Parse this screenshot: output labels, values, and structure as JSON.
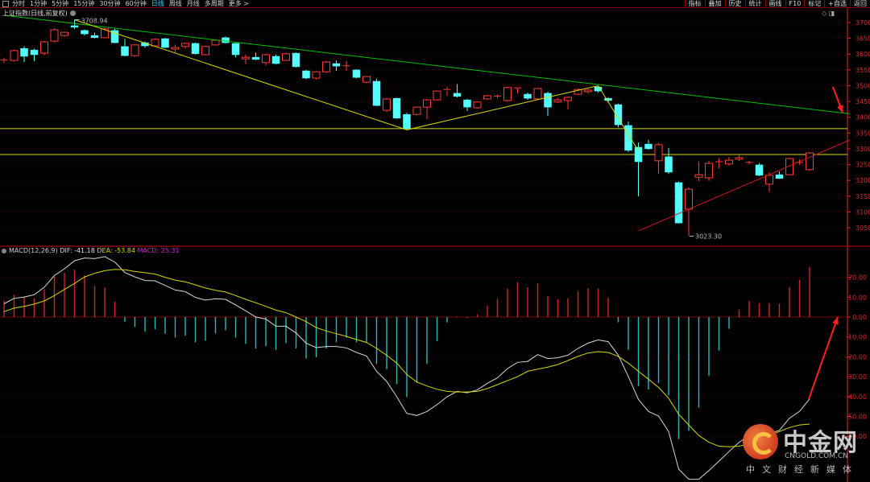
{
  "toolbar": {
    "periods": [
      "分时",
      "1分钟",
      "5分钟",
      "15分钟",
      "30分钟",
      "60分钟",
      "日线",
      "周线",
      "月线",
      "多周期",
      "更多 >"
    ],
    "active_period": "日线",
    "right_buttons": [
      "指标",
      "叠加",
      "历史",
      "统计",
      "画线",
      "F10",
      "标记",
      "+自选",
      "返回"
    ]
  },
  "title": "上证指数(日线,前复权)",
  "macd_header": {
    "name": "MACD(12,26,9)",
    "dif": "DIF: -41.18",
    "dea": "DEA: -53.84",
    "macd": "MACD: 25.31"
  },
  "annotations": {
    "high_label": "3708.94",
    "low_label": "3023.30"
  },
  "watermark": {
    "brand": "中金网",
    "url": "CNGOLD.COM.CN",
    "tagline": "中文财经新媒体"
  },
  "colors": {
    "up": "#ff3b3b",
    "down": "#54fcfc",
    "dif": "#d8d8d8",
    "dea": "#d8d800",
    "axis": "#e02828",
    "trend_green": "#00c000",
    "trend_yellow": "#d8d800",
    "trend_red": "#d01818"
  },
  "chart_data": [
    {
      "type": "candlestick",
      "title": "上证指数(日线,前复权)",
      "ylim": [
        3020,
        3720
      ],
      "yticks": [
        3700,
        3650,
        3600,
        3550,
        3500,
        3450,
        3400,
        3350,
        3300,
        3250,
        3200,
        3150,
        3100,
        3050
      ],
      "ohlc": [
        [
          3580,
          3588,
          3572,
          3581
        ],
        [
          3580,
          3614,
          3576,
          3611
        ],
        [
          3618,
          3625,
          3575,
          3593
        ],
        [
          3613,
          3617,
          3578,
          3598
        ],
        [
          3603,
          3642,
          3596,
          3639
        ],
        [
          3641,
          3682,
          3638,
          3677
        ],
        [
          3659,
          3671,
          3655,
          3669
        ],
        [
          3690,
          3709,
          3680,
          3685
        ],
        [
          3675,
          3678,
          3659,
          3664
        ],
        [
          3659,
          3668,
          3650,
          3652
        ],
        [
          3652,
          3683,
          3650,
          3680
        ],
        [
          3675,
          3680,
          3634,
          3636
        ],
        [
          3624,
          3648,
          3593,
          3595
        ],
        [
          3595,
          3631,
          3592,
          3629
        ],
        [
          3636,
          3640,
          3620,
          3626
        ],
        [
          3626,
          3649,
          3624,
          3647
        ],
        [
          3649,
          3651,
          3619,
          3621
        ],
        [
          3616,
          3630,
          3606,
          3621
        ],
        [
          3624,
          3637,
          3617,
          3634
        ],
        [
          3634,
          3636,
          3599,
          3601
        ],
        [
          3598,
          3627,
          3596,
          3624
        ],
        [
          3629,
          3646,
          3627,
          3644
        ],
        [
          3652,
          3656,
          3634,
          3636
        ],
        [
          3634,
          3636,
          3590,
          3598
        ],
        [
          3585,
          3598,
          3568,
          3590
        ],
        [
          3590,
          3605,
          3581,
          3583
        ],
        [
          3573,
          3601,
          3565,
          3598
        ],
        [
          3593,
          3598,
          3567,
          3570
        ],
        [
          3580,
          3604,
          3578,
          3601
        ],
        [
          3603,
          3605,
          3558,
          3560
        ],
        [
          3547,
          3550,
          3521,
          3524
        ],
        [
          3524,
          3546,
          3520,
          3544
        ],
        [
          3544,
          3578,
          3540,
          3575
        ],
        [
          3570,
          3580,
          3547,
          3562
        ],
        [
          3562,
          3578,
          3547,
          3563
        ],
        [
          3550,
          3552,
          3523,
          3526
        ],
        [
          3511,
          3531,
          3508,
          3529
        ],
        [
          3514,
          3522,
          3435,
          3437
        ],
        [
          3422,
          3460,
          3417,
          3458
        ],
        [
          3460,
          3462,
          3395,
          3397
        ],
        [
          3409,
          3414,
          3360,
          3364
        ],
        [
          3409,
          3434,
          3406,
          3432
        ],
        [
          3432,
          3457,
          3393,
          3455
        ],
        [
          3455,
          3485,
          3452,
          3483
        ],
        [
          3485,
          3497,
          3468,
          3488
        ],
        [
          3476,
          3505,
          3463,
          3466
        ],
        [
          3455,
          3458,
          3420,
          3432
        ],
        [
          3430,
          3450,
          3428,
          3448
        ],
        [
          3458,
          3471,
          3455,
          3468
        ],
        [
          3466,
          3472,
          3460,
          3467
        ],
        [
          3453,
          3496,
          3450,
          3494
        ],
        [
          3491,
          3494,
          3475,
          3493
        ],
        [
          3473,
          3478,
          3455,
          3460
        ],
        [
          3458,
          3493,
          3456,
          3491
        ],
        [
          3476,
          3481,
          3405,
          3432
        ],
        [
          3448,
          3460,
          3446,
          3455
        ],
        [
          3453,
          3466,
          3425,
          3463
        ],
        [
          3473,
          3491,
          3470,
          3488
        ],
        [
          3481,
          3490,
          3476,
          3486
        ],
        [
          3496,
          3500,
          3478,
          3483
        ],
        [
          3460,
          3463,
          3445,
          3453
        ],
        [
          3440,
          3443,
          3368,
          3376
        ],
        [
          3374,
          3386,
          3290,
          3295
        ],
        [
          3305,
          3320,
          3149,
          3259
        ],
        [
          3315,
          3328,
          3297,
          3300
        ],
        [
          3262,
          3318,
          3222,
          3313
        ],
        [
          3275,
          3303,
          3220,
          3226
        ],
        [
          3193,
          3196,
          3063,
          3065
        ],
        [
          3109,
          3177,
          3023.3,
          3172
        ],
        [
          3210,
          3260,
          3198,
          3218
        ],
        [
          3208,
          3262,
          3198,
          3254
        ],
        [
          3259,
          3270,
          3238,
          3259
        ],
        [
          3252,
          3274,
          3247,
          3264
        ],
        [
          3267,
          3280,
          3262,
          3272
        ],
        [
          3257,
          3262,
          3250,
          3257
        ],
        [
          3249,
          3255,
          3213,
          3216
        ],
        [
          3188,
          3225,
          3163,
          3216
        ],
        [
          3218,
          3228,
          3205,
          3206
        ],
        [
          3218,
          3272,
          3216,
          3269
        ],
        [
          3257,
          3266,
          3250,
          3257
        ],
        [
          3234,
          3290,
          3230,
          3287
        ]
      ],
      "hlines": [
        3364,
        3282
      ],
      "trendlines": [
        {
          "color": "green",
          "from": [
            0,
            3723
          ],
          "to": [
            84,
            3411
          ]
        },
        {
          "color": "yellow",
          "from": [
            7,
            3709
          ],
          "to": [
            40,
            3360
          ]
        },
        {
          "color": "yellow",
          "from": [
            40,
            3360
          ],
          "to": [
            59,
            3500
          ]
        },
        {
          "color": "yellow",
          "from": [
            59,
            3500
          ],
          "to": [
            63,
            3294
          ]
        },
        {
          "color": "red",
          "from": [
            63,
            3040
          ],
          "to": [
            84,
            3328
          ]
        }
      ]
    },
    {
      "type": "macd",
      "title": "MACD(12,26,9)",
      "ylim": [
        -82,
        32
      ],
      "yticks": [
        20,
        10,
        0,
        -10,
        -20,
        -30,
        -40,
        -50,
        -60
      ],
      "dif": [
        6.7,
        9.4,
        10.1,
        11.2,
        15.0,
        20.9,
        24.3,
        28.3,
        29.7,
        29.4,
        30.4,
        27.7,
        22.4,
        20.2,
        18.4,
        18.2,
        15.9,
        13.6,
        12.8,
        9.9,
        8.5,
        9.2,
        8.9,
        6.1,
        3.1,
        0,
        -1.0,
        -4.6,
        -4.6,
        -8.0,
        -13.1,
        -15.4,
        -14.8,
        -14.8,
        -15.5,
        -17.8,
        -19.6,
        -27.3,
        -32.4,
        -40.1,
        -48.5,
        -49.5,
        -47.5,
        -44.1,
        -40.1,
        -37.4,
        -38.1,
        -36.7,
        -33.3,
        -30.6,
        -25.9,
        -22.8,
        -22.3,
        -18.9,
        -20.9,
        -20.5,
        -19.2,
        -15.8,
        -13.1,
        -11.5,
        -12.4,
        -19.2,
        -29.9,
        -41.4,
        -47.5,
        -49.8,
        -57.6,
        -76.5,
        -81.6,
        -81.6,
        -77.2,
        -72.5,
        -67.7,
        -63.0,
        -59.6,
        -58.6,
        -58.6,
        -57.0,
        -50.9,
        -47.5,
        -41.18
      ],
      "dea": [
        2.7,
        4.5,
        5.4,
        6.5,
        8.1,
        10.8,
        13.9,
        16.9,
        20.2,
        22.0,
        23.3,
        24.0,
        23.8,
        22.9,
        22.3,
        21.6,
        20.0,
        18.6,
        17.7,
        16.2,
        14.6,
        13.5,
        12.6,
        10.8,
        8.9,
        7.2,
        5.4,
        3.5,
        2.2,
        0,
        -2.3,
        -5.3,
        -7.0,
        -8.4,
        -9.7,
        -11.3,
        -12.8,
        -15.8,
        -19.2,
        -23.2,
        -28.9,
        -32.7,
        -34.7,
        -36.3,
        -37.4,
        -37.7,
        -37.7,
        -37.4,
        -36.0,
        -34.0,
        -32.0,
        -30.0,
        -27.3,
        -26.2,
        -25.2,
        -23.9,
        -21.9,
        -19.8,
        -18.1,
        -17.4,
        -17.8,
        -19.8,
        -23.2,
        -27.3,
        -31.3,
        -35.4,
        -40.8,
        -48.9,
        -54.3,
        -59.6,
        -63.0,
        -65.0,
        -65.3,
        -65.0,
        -63.7,
        -61.7,
        -59.6,
        -57.6,
        -55.6,
        -54.3,
        -53.84
      ],
      "macd": [
        8.2,
        11.2,
        10.1,
        9.5,
        13.9,
        20.3,
        22.3,
        23.8,
        20.9,
        15.7,
        15.0,
        7.7,
        -2.4,
        -5.0,
        -7.4,
        -6.2,
        -8.4,
        -10.3,
        -9.4,
        -12.7,
        -11.9,
        -8.2,
        -6.6,
        -10.3,
        -13.5,
        -15.8,
        -14.7,
        -16.5,
        -13.1,
        -15.8,
        -20.9,
        -20.2,
        -15.8,
        -12.7,
        -10.4,
        -12.7,
        -12.8,
        -23.7,
        -26.2,
        -33.7,
        -40.3,
        -33.1,
        -23.6,
        -12.1,
        -2.7,
        0.4,
        -0.3,
        1.3,
        5.8,
        9.2,
        14.3,
        17.5,
        15.0,
        17.0,
        10.5,
        8.9,
        9.4,
        13.1,
        14.4,
        14.4,
        9.8,
        -2.6,
        -16.5,
        -34.7,
        -36.4,
        -33.3,
        -39.4,
        -61.4,
        -57.3,
        -45.5,
        -29.6,
        -16.8,
        -5.9,
        3.8,
        8.1,
        7.0,
        7.0,
        6.7,
        15.1,
        18.8,
        25.31
      ]
    }
  ]
}
